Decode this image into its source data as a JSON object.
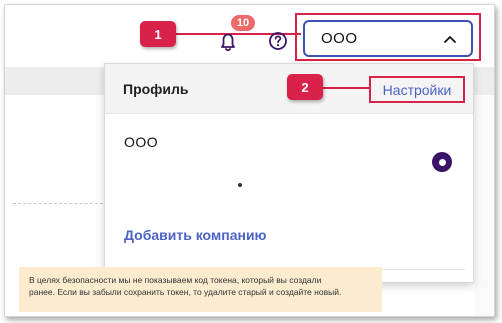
{
  "header": {
    "notifications_count": "10",
    "company_select_value": "ООО",
    "callout_1": "1",
    "callout_2": "2"
  },
  "dropdown": {
    "title": "Профиль",
    "settings_link": "Настройки",
    "companies": [
      {
        "name": "ООО",
        "selected": true
      }
    ],
    "add_company": "Добавить компанию"
  },
  "notice": {
    "line1": "В целях безопасности мы не показываем код токена, который вы создали",
    "line2": "ранее. Если вы забыли сохранить токен, то удалите старый и создайте новый."
  },
  "colors": {
    "annotation": "#d8224a",
    "link": "#4a63c4",
    "select_border": "#3f51b5",
    "radio_selected": "#3a1468",
    "badge": "#ef6b6b",
    "notice_bg": "#fbebcf"
  },
  "icons": {
    "notifications": "bell-icon",
    "help": "question-circle-icon",
    "select_toggle": "chevron-up-icon"
  }
}
